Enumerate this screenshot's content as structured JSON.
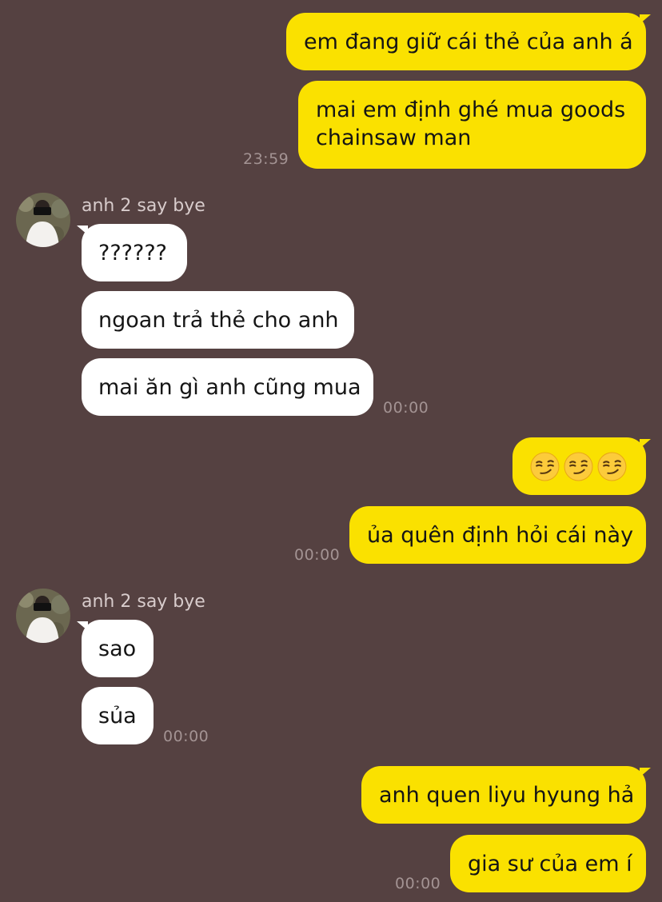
{
  "chat": {
    "contact_name": "anh 2 say bye",
    "messages": {
      "m1": "em đang giữ cái thẻ của anh á",
      "m2": "mai em định ghé mua goods chainsaw man",
      "t1": "23:59",
      "m3": "??????",
      "m4": "ngoan trả thẻ cho anh",
      "m5": "mai ăn gì anh cũng mua",
      "t2": "00:00",
      "m6_emoji": [
        "smirking-face",
        "smirking-face",
        "smirking-face"
      ],
      "m7": "ủa quên định hỏi cái này",
      "t3": "00:00",
      "m8": "sao",
      "m9": "sủa",
      "t4": "00:00",
      "m10": "anh quen liyu hyung hả",
      "m11": "gia sư của em í",
      "t5": "00:00"
    }
  },
  "colors": {
    "background": "#554141",
    "outgoing_bubble": "#fae100",
    "incoming_bubble": "#ffffff",
    "timestamp": "#a39393",
    "sender_name": "#d8cccc"
  }
}
